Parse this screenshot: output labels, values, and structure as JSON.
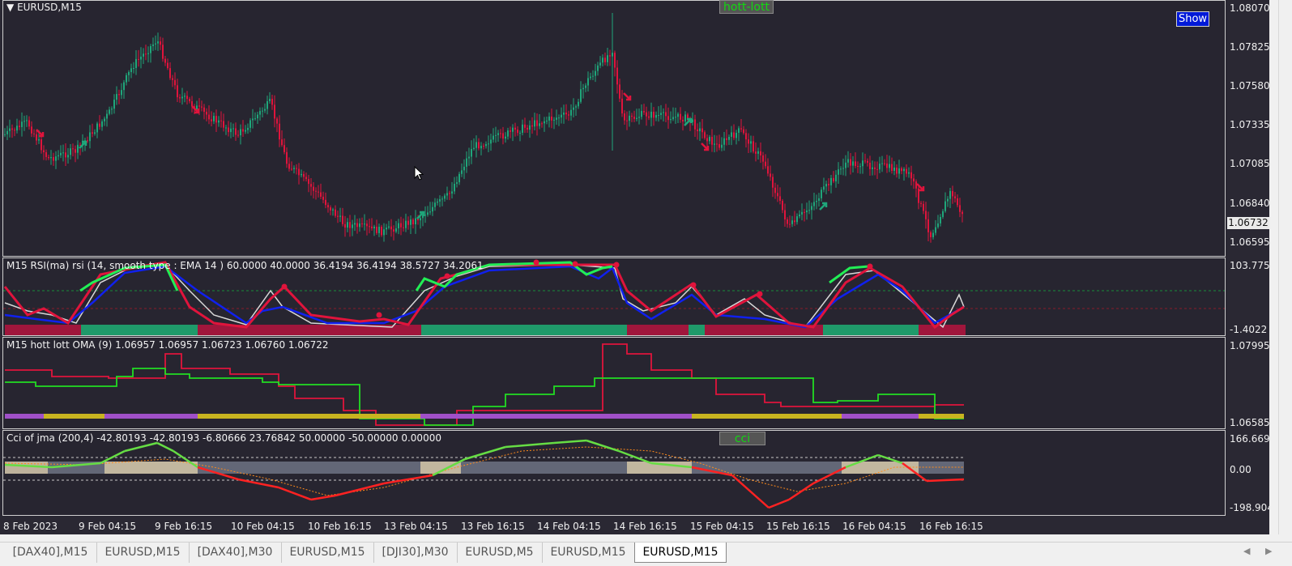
{
  "window": {
    "symbol_label": "EURUSD,M15",
    "hott_lott_button": "hott-lott",
    "cci_button": "cci",
    "show_button": "Show"
  },
  "panes": {
    "main": {
      "price_axis": [
        "1.08070",
        "1.07825",
        "1.07580",
        "1.07335",
        "1.07085",
        "1.06840",
        "1.06595"
      ],
      "current_price": "1.06732"
    },
    "rsi": {
      "label": "M15 RSI(ma) rsi (14, smooth type : EMA  14 ) 60.0000 40.0000 36.4194 36.4194 38.5727 34.2061",
      "axis": [
        "103.7758",
        "-1.4022"
      ]
    },
    "hott": {
      "label": "M15 hott lott OMA (9) 1.06957 1.06957 1.06723 1.06760 1.06722",
      "axis": [
        "1.07995",
        "1.06585"
      ]
    },
    "cci": {
      "label": "Cci of jma (200,4) -42.80193 -42.80193 -6.80666 23.76842 50.00000 -50.00000 0.00000",
      "axis": [
        "166.66902",
        "0.00",
        "-198.90472"
      ]
    }
  },
  "time_axis": [
    "8 Feb 2023",
    "9 Feb 04:15",
    "9 Feb 16:15",
    "10 Feb 04:15",
    "10 Feb 16:15",
    "13 Feb 04:15",
    "13 Feb 16:15",
    "14 Feb 04:15",
    "14 Feb 16:15",
    "15 Feb 04:15",
    "15 Feb 16:15",
    "16 Feb 04:15",
    "16 Feb 16:15"
  ],
  "tabs": [
    "[DAX40],M15",
    "EURUSD,M15",
    "[DAX40],M30",
    "EURUSD,M15",
    "[DJI30],M30",
    "EURUSD,M5",
    "EURUSD,M15",
    "EURUSD,M15"
  ],
  "active_tab_index": 7,
  "colors": {
    "background": "#272530",
    "bull": "#1fa67a",
    "bear": "#e0143c",
    "rsi_green": "#22ee55",
    "rsi_blue": "#1020ee",
    "hott_green": "#22dd22",
    "hott_red": "#e0143c",
    "show_button": "#0019d8"
  },
  "icons": {
    "scroll_left": "triangle-left",
    "scroll_right": "triangle-right",
    "dropdown": "triangle-down",
    "cursor": "mouse-pointer"
  }
}
